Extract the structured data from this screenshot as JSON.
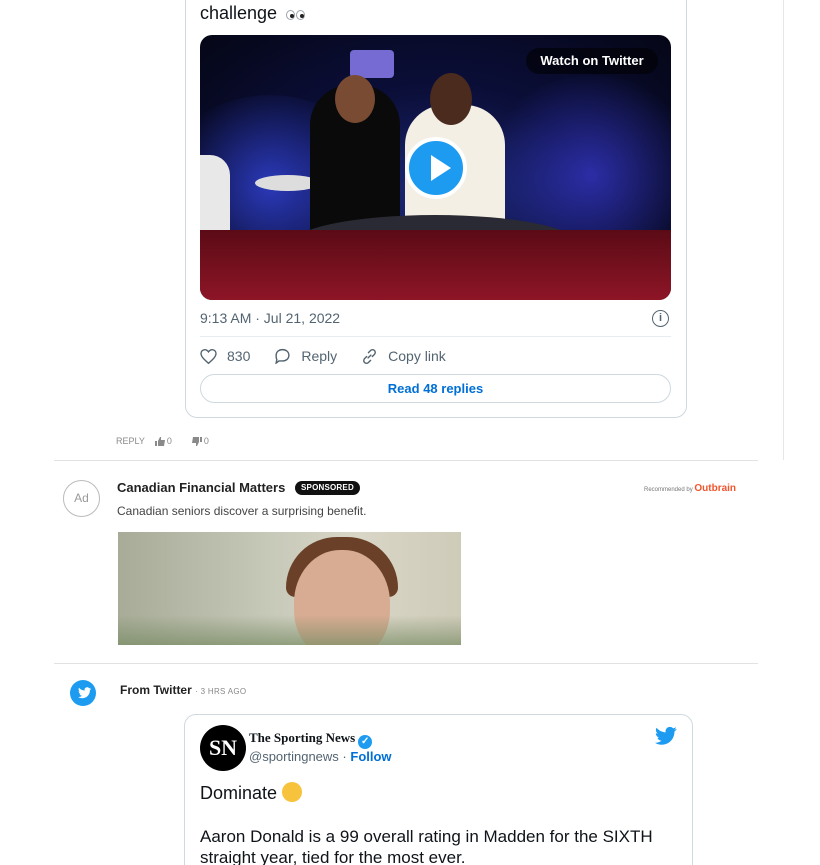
{
  "tweet1": {
    "text": "challenge",
    "watch_label": "Watch on Twitter",
    "timestamp": "9:13 AM · Jul 21, 2022",
    "likes": "830",
    "reply_label": "Reply",
    "copy_link_label": "Copy link",
    "read_replies_label": "Read 48 replies"
  },
  "comment_actions": {
    "reply_label": "REPLY",
    "upvotes": "0",
    "downvotes": "0"
  },
  "ad": {
    "badge": "Ad",
    "advertiser": "Canadian Financial Matters",
    "sponsored_label": "SPONSORED",
    "description": "Canadian seniors discover a surprising benefit.",
    "recommended_label": "Recommended by",
    "recommended_brand": "Outbrain"
  },
  "from_twitter": {
    "label": "From Twitter",
    "time_ago": "3 HRS AGO"
  },
  "tweet2": {
    "avatar_initials": "SN",
    "author_name": "The Sporting News",
    "handle": "@sportingnews",
    "separator": "·",
    "follow_label": "Follow",
    "line1": "Dominate",
    "line2": "Aaron Donald is a 99 overall rating in Madden for the SIXTH straight year, tied for the most ever."
  },
  "colors": {
    "twitter_blue": "#1d9bf0",
    "link_blue": "#006fd6",
    "outbrain_orange": "#f2552c"
  },
  "icons": [
    "eyes-emoji",
    "play-icon",
    "info-icon",
    "heart-icon",
    "reply-bubble-icon",
    "link-icon",
    "thumbs-up-icon",
    "thumbs-down-icon",
    "twitter-bird-icon",
    "verified-badge-icon",
    "flexed-biceps-emoji"
  ]
}
